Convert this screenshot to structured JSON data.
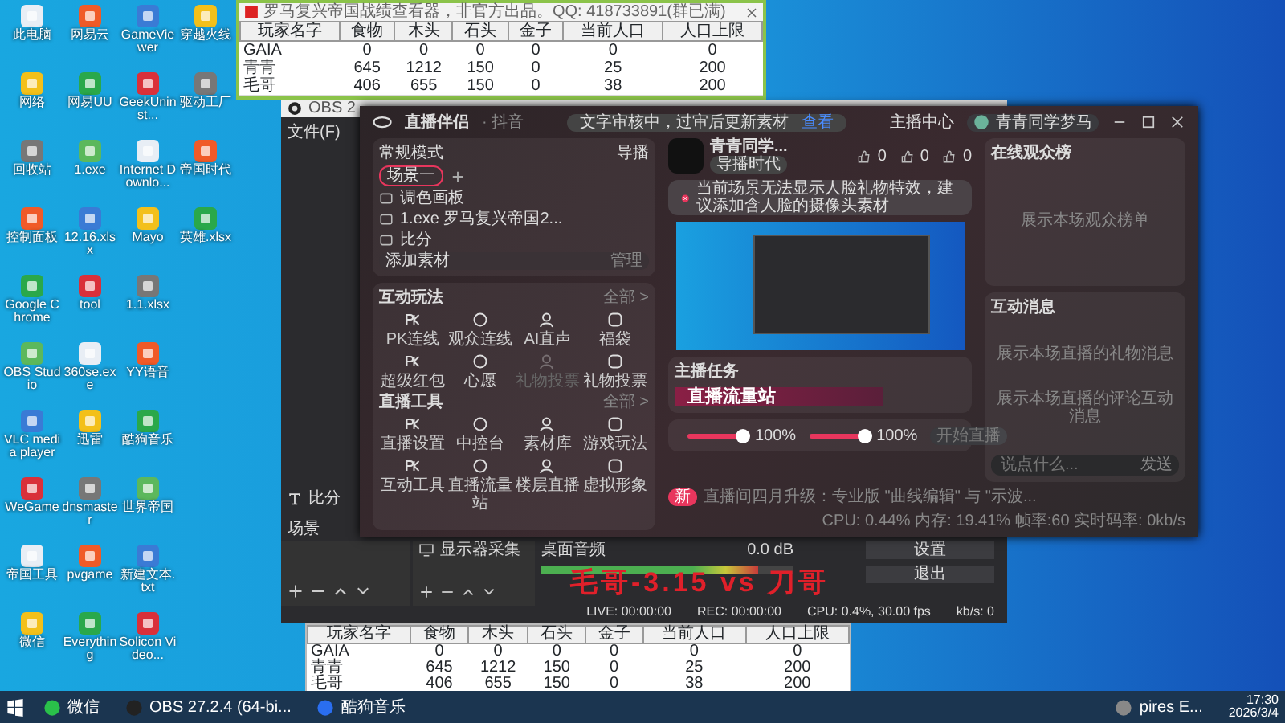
{
  "desktop_icon_rows": [
    [
      "此电脑",
      "网易云",
      "GameViewer",
      "穿越火线"
    ],
    [
      "网络",
      "网易UU",
      "GeekUninst...",
      "驱动工厂"
    ],
    [
      "回收站",
      "1.exe",
      "Internet Downlo...",
      "帝国时代"
    ],
    [
      "控制面板",
      "12.16.xlsx",
      "Mayo",
      "英雄.xlsx"
    ],
    [
      "Google Chrome",
      "tool",
      "1.1.xlsx"
    ],
    [
      "OBS Studio",
      "360se.exe",
      "YY语音"
    ],
    [
      "VLC media player",
      "迅雷",
      "酷狗音乐"
    ],
    [
      "WeGame",
      "dnsmaster",
      "世界帝国"
    ],
    [
      "帝国工具",
      "pvgame",
      "新建文本.txt"
    ],
    [
      "微信",
      "Everything",
      "Solicon Video..."
    ]
  ],
  "stats_window": {
    "title": "罗马复兴帝国战绩查看器，非官方出品。QQ: 418733891(群已满)",
    "columns": [
      "玩家名字",
      "食物",
      "木头",
      "石头",
      "金子",
      "当前人口",
      "人口上限"
    ],
    "rows": [
      [
        "GAIA",
        "0",
        "0",
        "0",
        "0",
        "0",
        "0"
      ],
      [
        "青青",
        "645",
        "1212",
        "150",
        "0",
        "25",
        "200"
      ],
      [
        "毛哥",
        "406",
        "655",
        "150",
        "0",
        "38",
        "200"
      ]
    ]
  },
  "obs_window": {
    "title": "OBS 2",
    "menu": "文件(F)",
    "source": "比分",
    "scenes_label": "场景",
    "source_capture": "显示器采集",
    "mixer": {
      "label": "桌面音频",
      "reading": "0.0 dB",
      "level": 0.86
    },
    "buttons": [
      "设置",
      "退出"
    ],
    "status": [
      "LIVE: 00:00:00",
      "REC: 00:00:00",
      "CPU: 0.4%, 30.00 fps",
      "kb/s: 0"
    ]
  },
  "overlay_text": "毛哥-3.15 vs 刀哥",
  "companion": {
    "title": "直播伴侣",
    "platform": "· 抖音",
    "toast": "文字审核中，过审后更新素材",
    "toast_link": "查看",
    "anchor_center": "主播中心",
    "user_name": "青青同学梦马",
    "mode": "常规模式",
    "director": "导播",
    "scene_tab": "场景一",
    "materials": [
      "调色画板",
      "1.exe 罗马复兴帝国2...",
      "比分"
    ],
    "add_material": "添加素材",
    "manage": "管理",
    "sections": [
      {
        "title": "互动玩法",
        "more": "全部 >",
        "items": [
          {
            "label": "PK连线",
            "disabled": false
          },
          {
            "label": "观众连线",
            "disabled": false
          },
          {
            "label": "AI直声",
            "disabled": false
          },
          {
            "label": "福袋",
            "disabled": false
          },
          {
            "label": "超级红包",
            "disabled": false
          },
          {
            "label": "心愿",
            "disabled": false
          },
          {
            "label": "礼物投票",
            "disabled": true
          },
          {
            "label": "礼物投票",
            "disabled": false
          }
        ]
      },
      {
        "title": "直播工具",
        "more": "全部 >",
        "items": [
          {
            "label": "直播设置",
            "disabled": false
          },
          {
            "label": "中控台",
            "disabled": false
          },
          {
            "label": "素材库",
            "disabled": false
          },
          {
            "label": "游戏玩法",
            "disabled": false
          },
          {
            "label": "互动工具",
            "disabled": false
          },
          {
            "label": "直播流量站",
            "disabled": false
          },
          {
            "label": "楼层直播",
            "disabled": false
          },
          {
            "label": "虚拟形象",
            "disabled": false
          }
        ]
      }
    ],
    "streamer_name": "青青同学...",
    "streamer_tag": "导播时代",
    "counters": [
      "0",
      "0",
      "0"
    ],
    "warning": "当前场景无法显示人脸礼物特效，建议添加含人脸的摄像头素材",
    "task_title": "主播任务",
    "task_banner": "直播流量站",
    "mic": {
      "level": 1.0,
      "reading": "100%"
    },
    "speaker": {
      "level": 1.0,
      "reading": "100%"
    },
    "start_button": "开始直播",
    "news_badge": "新",
    "news": "直播间四月升级：专业版 \"曲线编辑\" 与 \"示波...",
    "perf": "CPU: 0.44%  内存: 19.41%  帧率:60  实时码率: 0kb/s",
    "viewers_title": "在线观众榜",
    "viewers_empty": "展示本场观众榜单",
    "messages_title": "互动消息",
    "gift_empty": "展示本场直播的礼物消息",
    "comment_empty": "展示本场直播的评论互动消息",
    "chat_placeholder": "说点什么...",
    "send": "发送"
  },
  "bottom_table": {
    "columns": [
      "玩家名字",
      "食物",
      "木头",
      "石头",
      "金子",
      "当前人口",
      "人口上限"
    ],
    "rows": [
      [
        "GAIA",
        "0",
        "0",
        "0",
        "0",
        "0",
        "0"
      ],
      [
        "青青",
        "645",
        "1212",
        "150",
        "0",
        "25",
        "200"
      ],
      [
        "毛哥",
        "406",
        "655",
        "150",
        "0",
        "38",
        "200"
      ]
    ]
  },
  "taskbar": {
    "items": [
      "微信",
      "OBS 27.2.4 (64-bi...",
      "酷狗音乐",
      "pires E..."
    ],
    "time": "17:30",
    "date": "2026/3/4"
  }
}
